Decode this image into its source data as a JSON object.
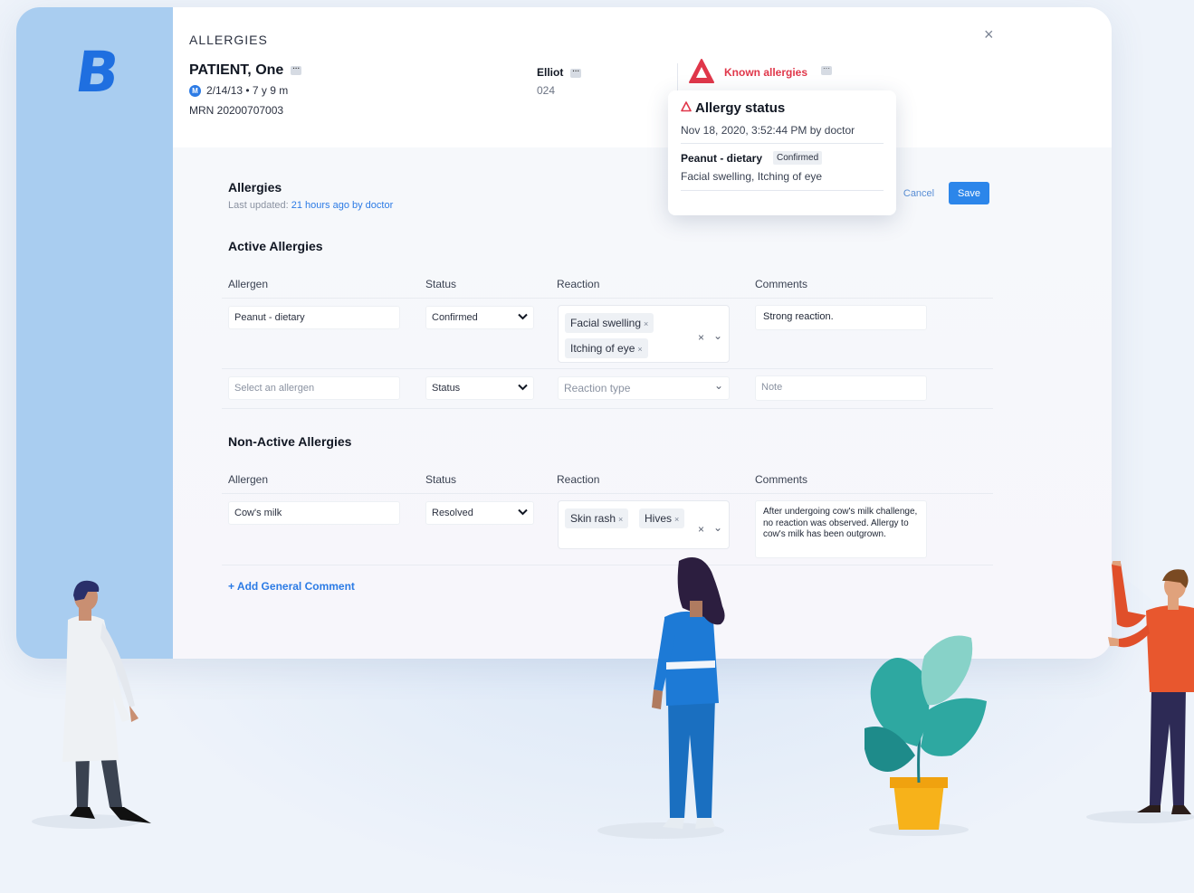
{
  "header": {
    "title": "ALLERGIES",
    "close_icon": "close-icon",
    "patient_name": "PATIENT, One",
    "patient_badge": "M",
    "patient_dob": "2/14/13 • 7 y 9 m",
    "mrn": "MRN 20200707003",
    "provider_name": "Elliot",
    "provider_sub": "024",
    "known_allergies": "Known allergies"
  },
  "popover": {
    "title": "Allergy status",
    "date": "Nov 18, 2020, 3:52:44 PM by doctor",
    "allergen": "Peanut - dietary",
    "badge": "Confirmed",
    "reaction": "Facial swelling, Itching of eye"
  },
  "actions": {
    "cancel": "Cancel",
    "save": "Save"
  },
  "allergies": {
    "title": "Allergies",
    "last_updated_label": "Last updated:",
    "last_updated_link": "21 hours ago by doctor"
  },
  "active": {
    "title": "Active Allergies",
    "columns": [
      "Allergen",
      "Status",
      "Reaction",
      "Comments"
    ],
    "row1": {
      "allergen": "Peanut - dietary",
      "status": "Confirmed",
      "reactions": [
        "Facial swelling",
        "Itching of eye"
      ],
      "comment": "Strong reaction."
    },
    "row2": {
      "allergen_placeholder": "Select an allergen",
      "status_placeholder": "Status",
      "reaction_placeholder": "Reaction type",
      "comment_placeholder": "Note"
    }
  },
  "nonactive": {
    "title": "Non-Active Allergies",
    "columns": [
      "Allergen",
      "Status",
      "Reaction",
      "Comments"
    ],
    "row1": {
      "allergen": "Cow's milk",
      "status": "Resolved",
      "reactions": [
        "Skin rash",
        "Hives"
      ],
      "comment": "After undergoing cow's milk challenge, no reaction was observed. Allergy to cow's milk has been outgrown."
    }
  },
  "add_comment": "+ Add General Comment",
  "colors": {
    "accent": "#2c7be5",
    "alert": "#e0374a",
    "sidebar": "#a9cdf0",
    "logo": "#1f6fe0"
  },
  "glyphs": {
    "remove": "×",
    "clear": "×",
    "chevron": "⌄",
    "bold_chevron": "❯",
    "more": "···"
  }
}
